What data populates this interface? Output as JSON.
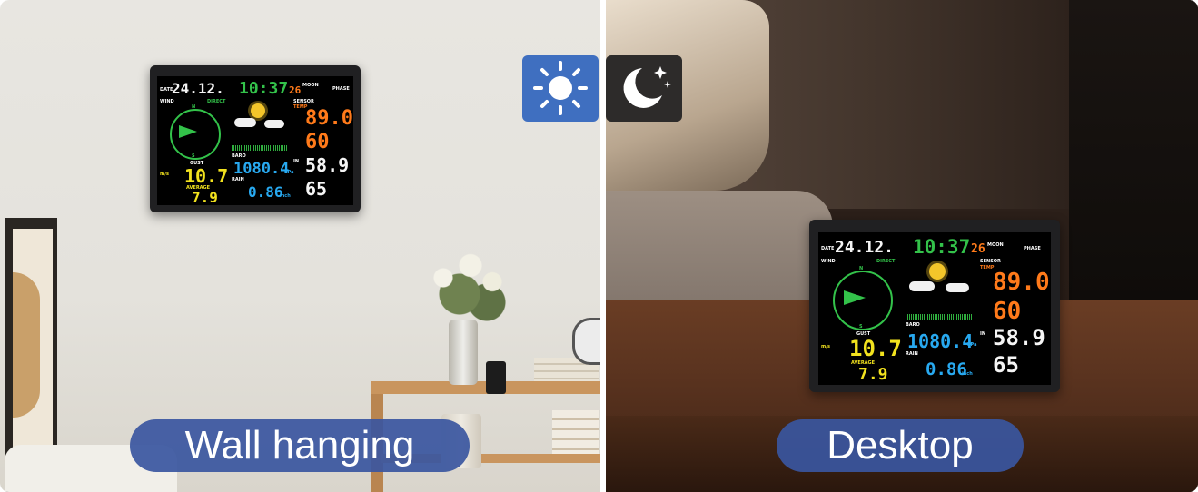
{
  "scene_left": {
    "caption": "Wall hanging"
  },
  "scene_right": {
    "caption": "Desktop"
  },
  "mode_toggle": {
    "day_icon": "sun-icon",
    "night_icon": "moon-icon",
    "active": "day",
    "active_color": "#3f6fc0",
    "inactive_color": "#2d2b2a"
  },
  "station": {
    "date_label": "DATE",
    "date": "24.12.",
    "time": "10:37",
    "day": "26",
    "moon_label": "MOON",
    "phase_label": "PHASE",
    "wind_label": "WIND",
    "direct_label": "DIRECT",
    "compass": {
      "n": "N",
      "s": "S",
      "nw": "NW",
      "ne": "NE",
      "sw": "SW",
      "se": "SE"
    },
    "gust_label": "GUST",
    "gust_value": "10.7",
    "ms_label": "m/s",
    "average_label": "AVERAGE",
    "average_value": "7.9",
    "baro_label": "BARO",
    "abs_label": "ABS",
    "baro_value": "1080.4",
    "baro_unit": "hPa",
    "rain_label": "RAIN",
    "rain_24h_label": "24H",
    "rain_value": "0.86",
    "rain_unit": "inch",
    "sensor_label": "SENSOR",
    "temp_label": "TEMP",
    "out_temp": "89.0",
    "out_temp_unit": "°F",
    "out_hum": "60",
    "out_hum_unit": "%",
    "in_label": "IN",
    "in_temp": "58.9",
    "in_hum": "65",
    "colors": {
      "green": "#33c24a",
      "yellow": "#f2e21e",
      "orange": "#ff7a1a",
      "cyan": "#28a9f0",
      "white": "#f5f5f5"
    }
  }
}
